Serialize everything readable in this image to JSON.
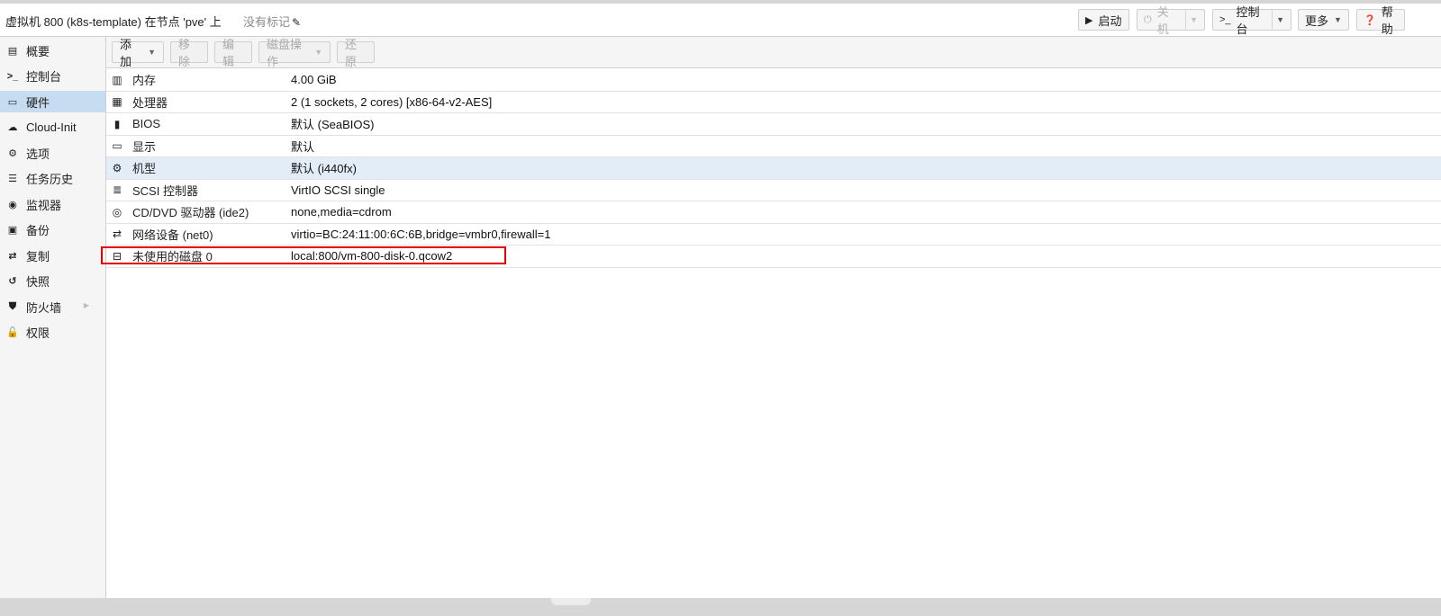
{
  "header": {
    "title": "虚拟机 800 (k8s-template) 在节点 'pve' 上",
    "tags_placeholder": "没有标记",
    "buttons": {
      "start": "启动",
      "shutdown": "关机",
      "console": "控制台",
      "more": "更多",
      "help": "帮助"
    }
  },
  "sidebar": {
    "items": [
      {
        "label": "概要",
        "icon": "book-icon"
      },
      {
        "label": "控制台",
        "icon": "terminal-icon"
      },
      {
        "label": "硬件",
        "icon": "desktop-icon",
        "active": true
      },
      {
        "label": "Cloud-Init",
        "icon": "cloud-icon"
      },
      {
        "label": "选项",
        "icon": "gear-icon"
      },
      {
        "label": "任务历史",
        "icon": "list-icon"
      },
      {
        "label": "监视器",
        "icon": "eye-icon"
      },
      {
        "label": "备份",
        "icon": "floppy-icon"
      },
      {
        "label": "复制",
        "icon": "retweet-icon"
      },
      {
        "label": "快照",
        "icon": "history-icon"
      },
      {
        "label": "防火墙",
        "icon": "shield-icon"
      },
      {
        "label": "权限",
        "icon": "unlock-icon"
      }
    ]
  },
  "toolbar": {
    "add": "添加",
    "remove": "移除",
    "edit": "编辑",
    "disk_action": "磁盘操作",
    "revert": "还原"
  },
  "hardware": [
    {
      "name": "内存",
      "value": "4.00 GiB",
      "icon": "memory-icon"
    },
    {
      "name": "处理器",
      "value": "2 (1 sockets, 2 cores) [x86-64-v2-AES]",
      "icon": "cpu-icon"
    },
    {
      "name": "BIOS",
      "value": "默认 (SeaBIOS)",
      "icon": "microchip-icon"
    },
    {
      "name": "显示",
      "value": "默认",
      "icon": "monitor-icon"
    },
    {
      "name": "机型",
      "value": "默认 (i440fx)",
      "icon": "cogs-icon",
      "selected": true
    },
    {
      "name": "SCSI 控制器",
      "value": "VirtIO SCSI single",
      "icon": "database-icon"
    },
    {
      "name": "CD/DVD 驱动器 (ide2)",
      "value": "none,media=cdrom",
      "icon": "cdrom-icon"
    },
    {
      "name": "网络设备 (net0)",
      "value": "virtio=BC:24:11:00:6C:6B,bridge=vmbr0,firewall=1",
      "icon": "exchange-icon"
    },
    {
      "name": "未使用的磁盘 0",
      "value": "local:800/vm-800-disk-0.qcow2",
      "icon": "hdd-icon"
    }
  ]
}
